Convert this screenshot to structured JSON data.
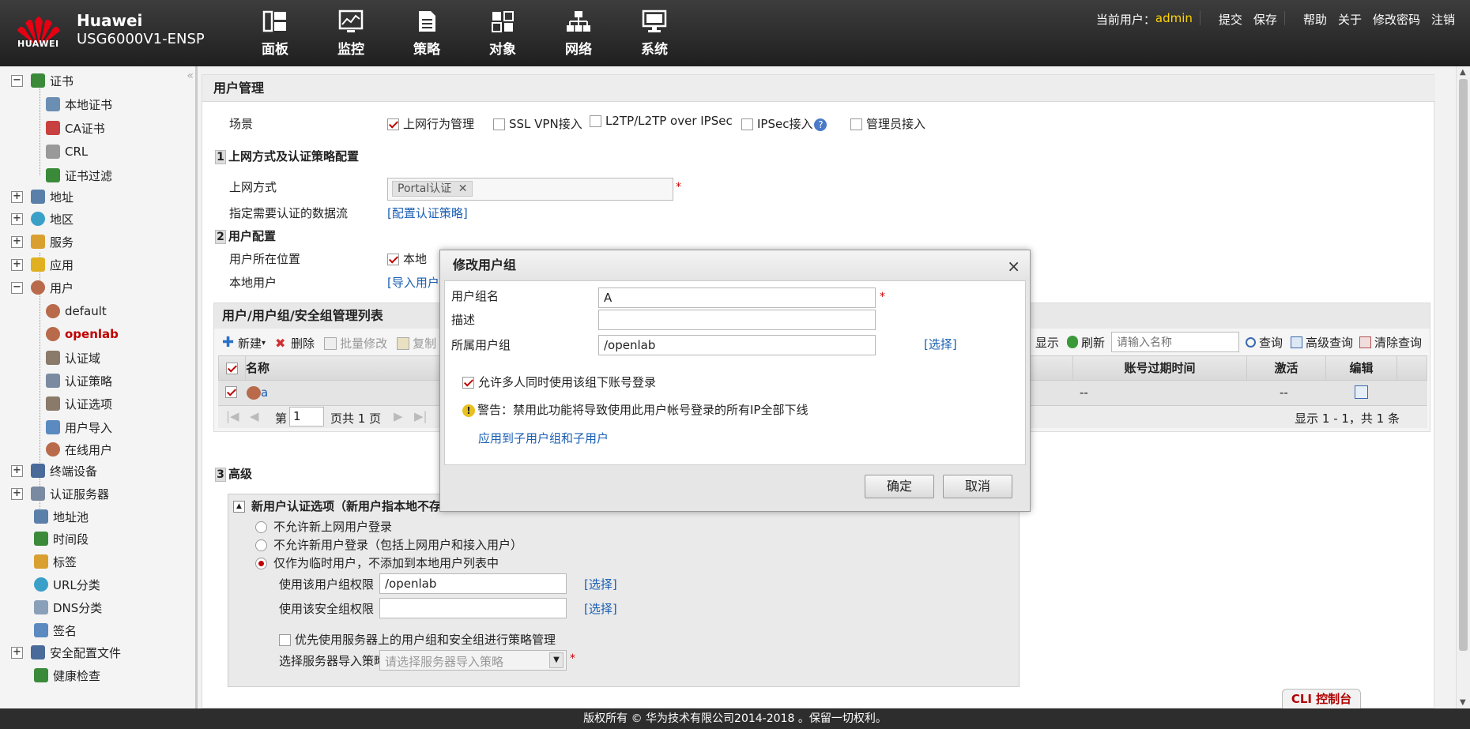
{
  "brand": {
    "name": "Huawei",
    "model": "USG6000V1-ENSP",
    "logo_text": "HUAWEI"
  },
  "nav": [
    {
      "label": "面板",
      "icon": "dashboard-icon"
    },
    {
      "label": "监控",
      "icon": "monitor-icon"
    },
    {
      "label": "策略",
      "icon": "policy-icon"
    },
    {
      "label": "对象",
      "icon": "object-icon"
    },
    {
      "label": "网络",
      "icon": "network-icon"
    },
    {
      "label": "系统",
      "icon": "system-icon"
    }
  ],
  "toplinks": {
    "current_user_label": "当前用户：",
    "user": "admin",
    "submit": "提交",
    "save": "保存",
    "help": "帮助",
    "about": "关于",
    "change_password": "修改密码",
    "logout": "注销"
  },
  "sidebar": {
    "items": [
      {
        "label": "证书"
      },
      {
        "label": "本地证书"
      },
      {
        "label": "CA证书"
      },
      {
        "label": "CRL"
      },
      {
        "label": "证书过滤"
      },
      {
        "label": "地址"
      },
      {
        "label": "地区"
      },
      {
        "label": "服务"
      },
      {
        "label": "应用"
      },
      {
        "label": "用户"
      },
      {
        "label": "default"
      },
      {
        "label": "openlab"
      },
      {
        "label": "认证域"
      },
      {
        "label": "认证策略"
      },
      {
        "label": "认证选项"
      },
      {
        "label": "用户导入"
      },
      {
        "label": "在线用户"
      },
      {
        "label": "终端设备"
      },
      {
        "label": "认证服务器"
      },
      {
        "label": "地址池"
      },
      {
        "label": "时间段"
      },
      {
        "label": "标签"
      },
      {
        "label": "URL分类"
      },
      {
        "label": "DNS分类"
      },
      {
        "label": "签名"
      },
      {
        "label": "安全配置文件"
      },
      {
        "label": "健康检查"
      }
    ],
    "collapse_glyph": "«"
  },
  "main": {
    "title": "用户管理",
    "scene_label": "场景",
    "scenes": [
      {
        "label": "上网行为管理",
        "checked": true
      },
      {
        "label": "SSL VPN接入",
        "checked": false
      },
      {
        "label": "L2TP/L2TP over IPSec",
        "checked": false
      },
      {
        "label": "IPSec接入",
        "checked": false
      },
      {
        "label": "管理员接入",
        "checked": false
      }
    ],
    "section1": {
      "num": "1",
      "title": "上网方式及认证策略配置",
      "access_label": "上网方式",
      "access_tag": "Portal认证",
      "flow_label": "指定需要认证的数据流",
      "flow_link": "[配置认证策略]"
    },
    "section2": {
      "num": "2",
      "title": "用户配置",
      "location_label": "用户所在位置",
      "location_value": "本地",
      "local_user_label": "本地用户",
      "import_link": "[导入用户]"
    },
    "list": {
      "title": "用户/用户组/安全组管理列表",
      "toolbar": {
        "new": "新建",
        "delete": "删除",
        "batch_edit": "批量修改",
        "copy": "复制",
        "show": "显示",
        "refresh": "刷新",
        "search_placeholder": "请输入名称",
        "query": "查询",
        "advanced_query": "高级查询",
        "clear_query": "清除查询"
      },
      "columns": {
        "name": "名称",
        "expire": "账号过期时间",
        "active": "激活",
        "edit": "编辑"
      },
      "row": {
        "name": "a",
        "expire": "--",
        "active": "--"
      },
      "pager": {
        "page_prefix": "第",
        "page": "1",
        "page_suffix": "页共 1 页",
        "summary": "显示 1 - 1，共 1 条"
      }
    },
    "section3": {
      "num": "3",
      "title": "高级",
      "new_user_title": "新用户认证选项（新用户指本地不存",
      "opt1": "不允许新上网用户登录",
      "opt2": "不允许新用户登录（包括上网用户和接入用户）",
      "opt3": "仅作为临时用户，不添加到本地用户列表中",
      "group_perm_label": "使用该用户组权限",
      "group_perm_value": "/openlab",
      "sec_perm_label": "使用该安全组权限",
      "select_link": "[选择]",
      "prefer_server": "优先使用服务器上的用户组和安全组进行策略管理",
      "import_policy_label": "选择服务器导入策略",
      "import_policy_placeholder": "请选择服务器导入策略"
    }
  },
  "dialog": {
    "title": "修改用户组",
    "close": "×",
    "name_label": "用户组名",
    "name_value": "A",
    "desc_label": "描述",
    "desc_value": "",
    "parent_label": "所属用户组",
    "parent_value": "/openlab",
    "select_link": "[选择]",
    "multi_login": "允许多人同时使用该组下账号登录",
    "warning": "警告：禁用此功能将导致使用此用户帐号登录的所有IP全部下线",
    "apply_link": "应用到子用户组和子用户",
    "ok": "确定",
    "cancel": "取消"
  },
  "footer": {
    "copyright": "版权所有 © 华为技术有限公司2014-2018 。保留一切权利。",
    "cli": "CLI 控制台"
  },
  "colors": {
    "accent": "#c00000",
    "link": "#1a5fb4",
    "user": "#ffd400"
  }
}
